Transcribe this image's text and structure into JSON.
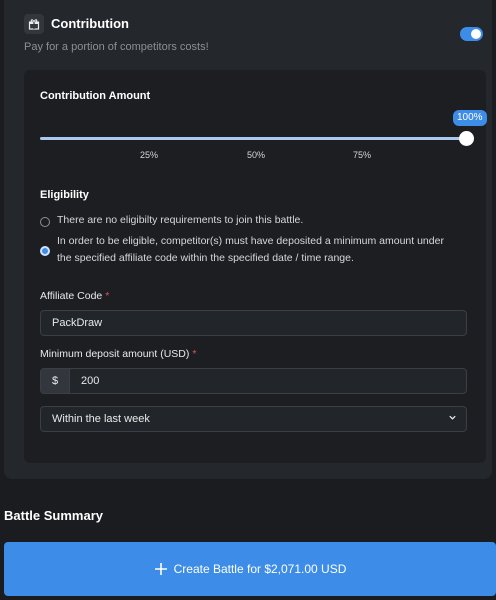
{
  "contribution": {
    "title": "Contribution",
    "subtitle": "Pay for a portion of competitors costs!",
    "enabled": true,
    "accent_color": "#3d8de8"
  },
  "amount": {
    "label": "Contribution Amount",
    "value_label": "100%",
    "value": 1.0,
    "ticks": [
      "25%",
      "50%",
      "75%"
    ]
  },
  "eligibility": {
    "label": "Eligibility",
    "options": [
      {
        "text": "There are no eligibilty requirements to join this battle.",
        "selected": false
      },
      {
        "text_line1": "In order to be eligible, competitor(s) must have deposited a minimum amount under",
        "text_line2": "the specified affiliate code within the specified date / time range.",
        "selected": true
      }
    ]
  },
  "affiliate": {
    "label": "Affiliate Code",
    "required_mark": "*",
    "value": "PackDraw"
  },
  "deposit": {
    "label": "Minimum deposit amount (USD)",
    "required_mark": "*",
    "prefix": "$",
    "value": "200"
  },
  "range": {
    "selected": "Within the last week"
  },
  "summary": {
    "title": "Battle Summary"
  },
  "create": {
    "label": "Create Battle for $2,071.00 USD"
  }
}
